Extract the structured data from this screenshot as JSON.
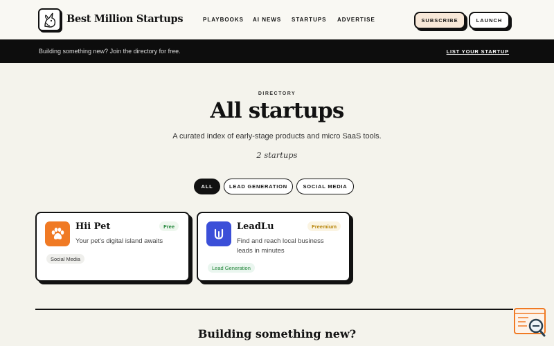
{
  "header": {
    "brand": "Best Million Startups",
    "nav": [
      "PLAYBOOKS",
      "AI NEWS",
      "STARTUPS",
      "ADVERTISE"
    ],
    "subscribe_label": "SUBSCRIBE",
    "launch_label": "LAUNCH"
  },
  "banner": {
    "text": "Building something new? Join the directory for free.",
    "link": "LIST YOUR STARTUP"
  },
  "hero": {
    "eyebrow": "DIRECTORY",
    "title": "All startups",
    "subtitle": "A curated index of early-stage products and micro SaaS tools.",
    "count": "2 startups"
  },
  "filters": [
    "ALL",
    "LEAD GENERATION",
    "SOCIAL MEDIA"
  ],
  "cards": [
    {
      "name": "Hii Pet",
      "desc": "Your pet's digital island awaits",
      "price": "Free",
      "tag": "Social Media",
      "icon": "paw-icon",
      "icon_color": "#f07a24"
    },
    {
      "name": "LeadLu",
      "desc": "Find and reach local business leads in minutes",
      "price": "Freemium",
      "tag": "Lead Generation",
      "icon": "leadlu-logo-icon",
      "icon_color": "#3b4fd8"
    }
  ],
  "footer": {
    "title": "Building something new?"
  },
  "colors": {
    "background": "#f4f3ec",
    "banner": "#0d0d0d",
    "subscribe_bg": "#f8e8d8",
    "accent_orange": "#f07a24",
    "accent_blue": "#3b4fd8"
  }
}
